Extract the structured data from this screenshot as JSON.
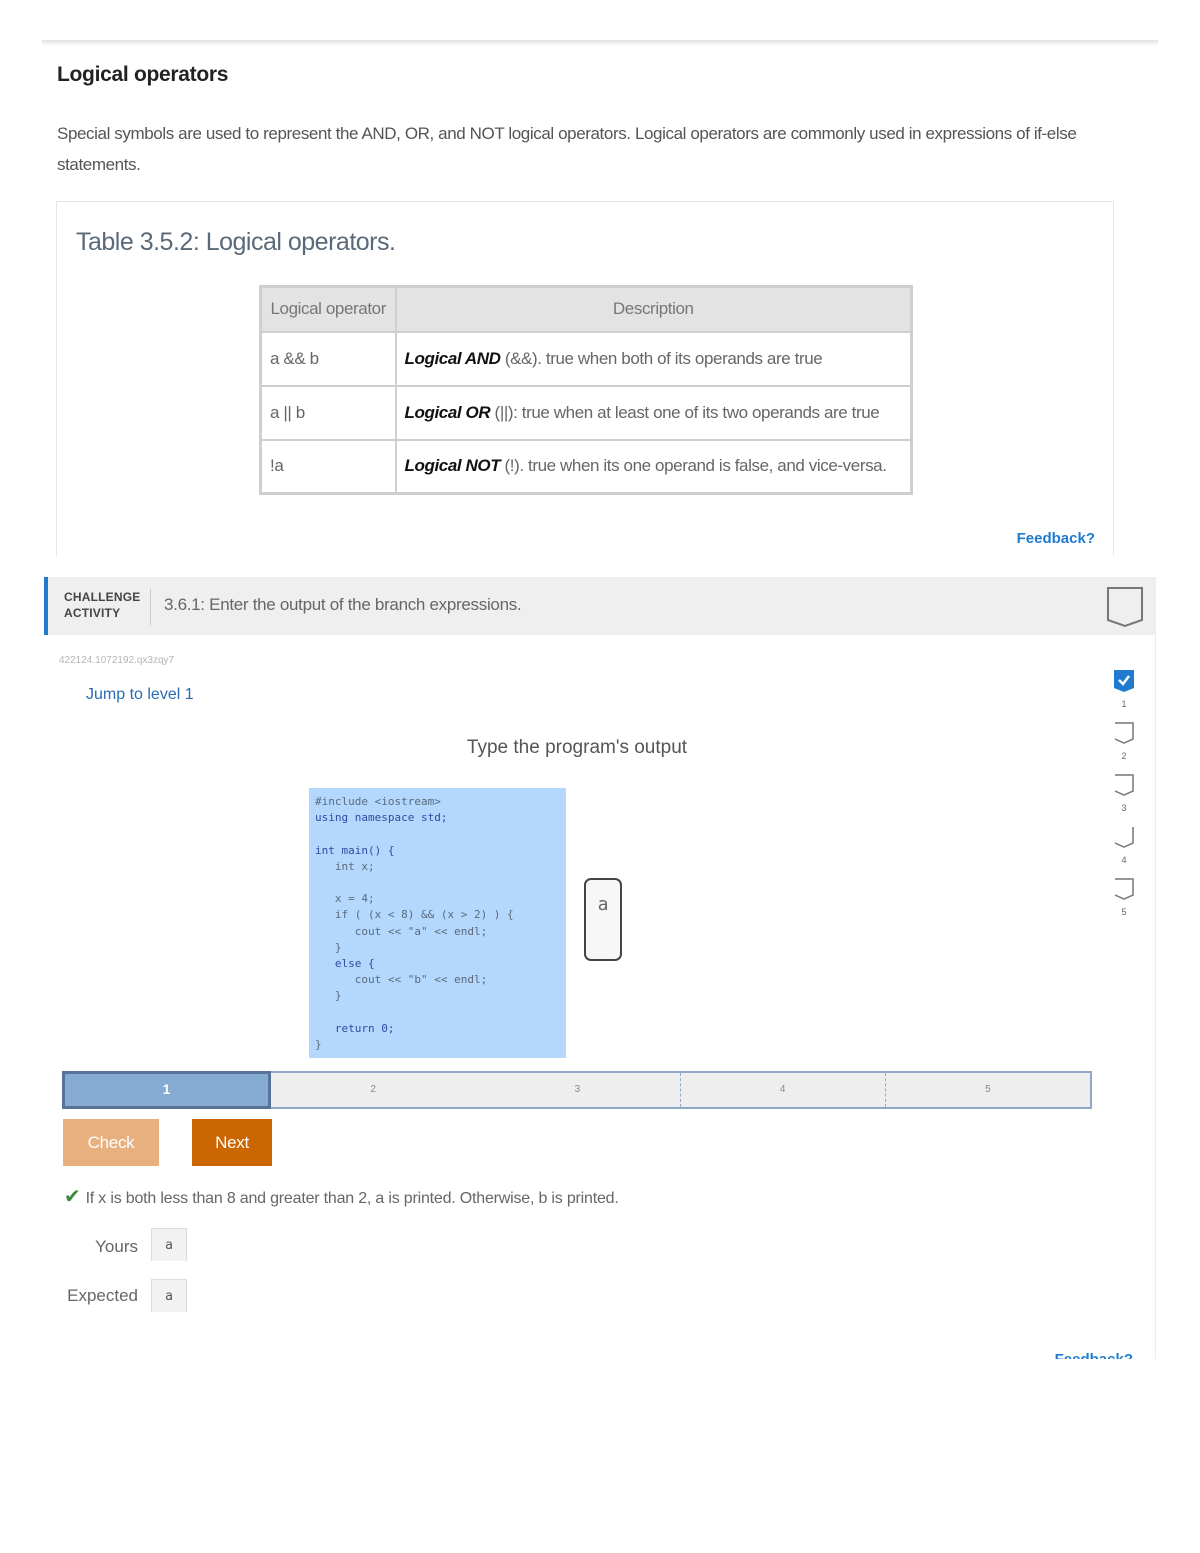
{
  "section": {
    "title": "Logical operators",
    "intro": "Special symbols are used to represent the AND, OR, and NOT logical operators. Logical operators are commonly used in expressions of if-else statements."
  },
  "table": {
    "caption": "Table 3.5.2: Logical operators.",
    "headers": [
      "Logical operator",
      "Description"
    ],
    "rows": [
      {
        "op": "a && b",
        "name": "Logical AND",
        "rest": " (&&). true when both of its operands are true"
      },
      {
        "op": "a || b",
        "name": "Logical OR",
        "rest": " (||): true when at least one of its two operands are true"
      },
      {
        "op": "!a",
        "name": "Logical NOT",
        "rest": " (!). true when its one operand is false, and vice-versa."
      }
    ],
    "feedback_label": "Feedback?"
  },
  "challenge": {
    "badge_line1": "CHALLENGE",
    "badge_line2": "ACTIVITY",
    "title": "3.6.1: Enter the output of the branch expressions.",
    "id_text": "422124.1072192.qx3zqy7",
    "jump_label": "Jump to level 1",
    "levels": [
      {
        "num": "1",
        "completed": true
      },
      {
        "num": "2",
        "completed": false
      },
      {
        "num": "3",
        "completed": false
      },
      {
        "num": "4",
        "completed": false
      },
      {
        "num": "5",
        "completed": false
      }
    ],
    "prompt": "Type the program's output",
    "code": {
      "l1": "#include <iostream>",
      "l2": "using namespace std;",
      "l3": "int main() {",
      "l4": "   int x;",
      "l5": "   x = 4;",
      "l6": "   if ( (x < 8) && (x > 2) ) {",
      "l7": "      cout << \"a\" << endl;",
      "l8": "   }",
      "l9": "   else {",
      "l10": "      cout << \"b\" << endl;",
      "l11": "   }",
      "l12": "   return 0;",
      "l13": "}"
    },
    "answer_value": "a",
    "progress": {
      "current": "1",
      "segments": [
        "1",
        "2",
        "3",
        "4",
        "5"
      ]
    },
    "check_label": "Check",
    "next_label": "Next",
    "explanation": "If x is both less than 8 and greater than 2, a is printed. Otherwise, b is printed.",
    "yours_label": "Yours",
    "yours_value": "a",
    "expected_label": "Expected",
    "expected_value": "a",
    "feedback_label": "Feedback?",
    "colors": {
      "accent": "#1f7bd0",
      "check_button": "#e8b07e",
      "next_button": "#cc6600",
      "progress_active": "#86abd2",
      "code_bg": "#b3d7fd"
    }
  }
}
